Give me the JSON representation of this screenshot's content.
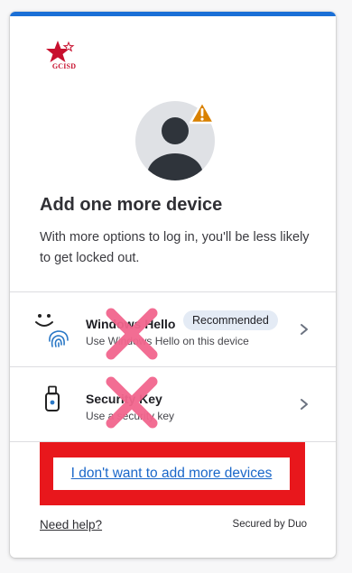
{
  "logo": {
    "text": "GCISD"
  },
  "heading": {
    "title": "Add one more device",
    "subtitle": "With more options to log in, you'll be less likely to get locked out."
  },
  "options": [
    {
      "title": "Windows Hello",
      "subtitle": "Use Windows Hello on this device",
      "badge": "Recommended",
      "icon": "windows-hello-fingerprint-icon"
    },
    {
      "title": "Security Key",
      "subtitle": "Use a security key",
      "icon": "usb-security-key-icon"
    }
  ],
  "skip_link": "I don't want to add more devices",
  "footer": {
    "help": "Need help?",
    "secured_by": "Secured by Duo"
  },
  "colors": {
    "accent_bar": "#1a6fd6",
    "link": "#1a67c9",
    "highlight_box": "#e8171c",
    "x_mark": "#f2668e",
    "warning": "#d98100"
  }
}
